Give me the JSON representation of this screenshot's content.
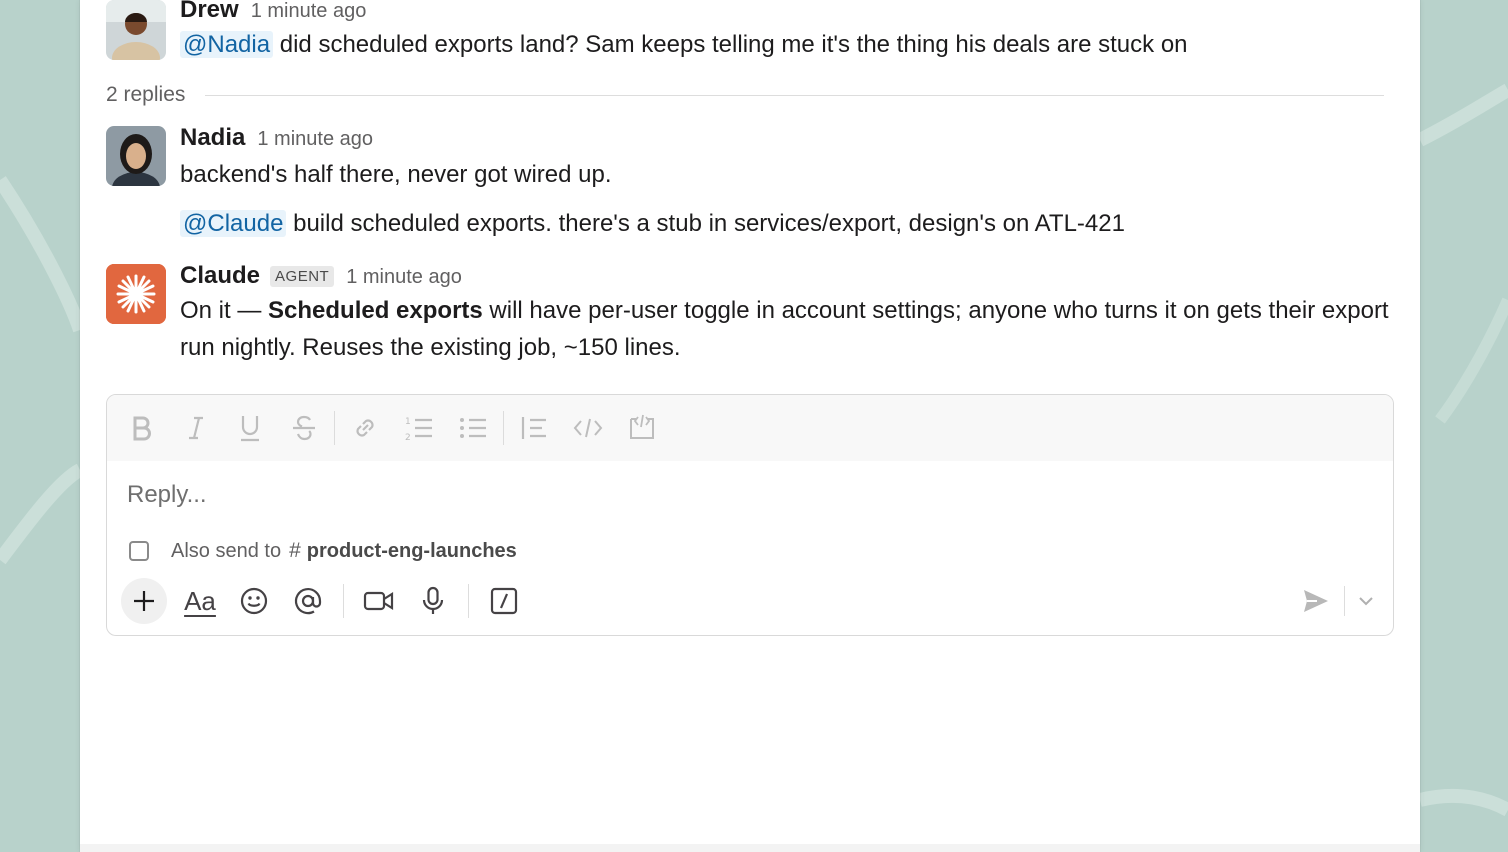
{
  "colors": {
    "background": "#b8d2cb",
    "mention_text": "#1264a3",
    "mention_bg": "#e8f3fb",
    "claude_avatar": "#e1673f"
  },
  "messages": [
    {
      "author": "Drew",
      "time": "1 minute ago",
      "mention": "@Nadia",
      "text": " did scheduled exports land? Sam keeps telling me it's the thing his deals are stuck on",
      "avatar_icon": "person-photo-avatar"
    },
    {
      "author": "Nadia",
      "time": "1 minute ago",
      "text": "backend's half there, never got wired up.",
      "followup_mention": "@Claude",
      "followup_text": " build scheduled exports. there's a stub in services/export, design's on ATL-421",
      "avatar_icon": "person-photo-avatar"
    },
    {
      "author": "Claude",
      "badge": "AGENT",
      "time": "1 minute ago",
      "text_prefix": "On it — ",
      "text_bold": "Scheduled exports",
      "text_suffix": " will have per-user toggle in account settings; anyone who turns it on gets their export run nightly. Reuses the existing job, ~150 lines.",
      "avatar_icon": "claude-starburst-icon"
    }
  ],
  "thread": {
    "replies_label": "2 replies"
  },
  "composer": {
    "placeholder": "Reply...",
    "also_send_label": "Also send to",
    "channel_hash": "#",
    "channel_name": "product-eng-launches",
    "also_send_checked": false,
    "format_buttons": [
      "bold-icon",
      "italic-icon",
      "underline-icon",
      "strikethrough-icon",
      "link-icon",
      "ordered-list-icon",
      "bulleted-list-icon",
      "blockquote-icon",
      "code-icon",
      "code-block-icon"
    ],
    "action_buttons": [
      "plus-icon",
      "text-format-icon",
      "emoji-icon",
      "mention-icon",
      "video-icon",
      "microphone-icon",
      "slash-command-icon"
    ],
    "text_format_label": "Aa"
  }
}
